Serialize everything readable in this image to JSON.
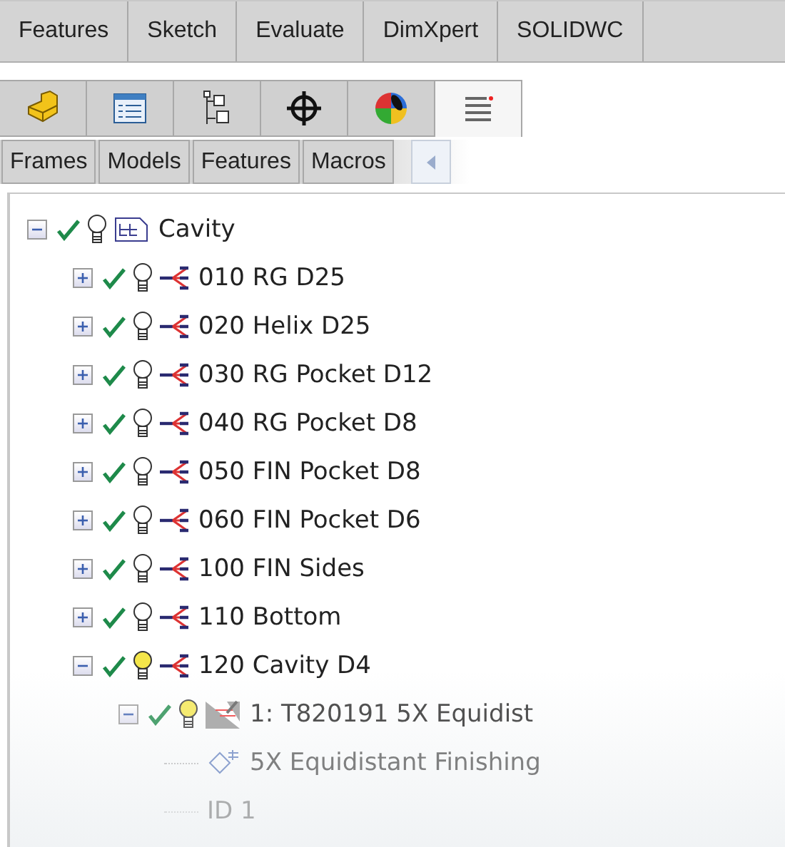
{
  "command_tabs": [
    {
      "label": "Features",
      "selected": false
    },
    {
      "label": "Sketch",
      "selected": false
    },
    {
      "label": "Evaluate",
      "selected": false
    },
    {
      "label": "DimXpert",
      "selected": false
    },
    {
      "label": "SOLIDWC",
      "selected": false
    }
  ],
  "panel_tabs": [
    {
      "kind": "part",
      "selected": false
    },
    {
      "kind": "property",
      "selected": false
    },
    {
      "kind": "config",
      "selected": false
    },
    {
      "kind": "target",
      "selected": false
    },
    {
      "kind": "appearance",
      "selected": false
    },
    {
      "kind": "list",
      "selected": true
    }
  ],
  "sub_tabs": [
    {
      "label": "Frames",
      "selected": false
    },
    {
      "label": "Models",
      "selected": false
    },
    {
      "label": "Features",
      "selected": false
    },
    {
      "label": "Macros",
      "selected": false
    }
  ],
  "tree": [
    {
      "kind": "part",
      "label": "Cavity",
      "expanded": true,
      "checked": true,
      "lit": false,
      "children": [
        {
          "kind": "group",
          "label": "010 RG D25",
          "expanded": false,
          "checked": true,
          "lit": false
        },
        {
          "kind": "group",
          "label": "020 Helix D25",
          "expanded": false,
          "checked": true,
          "lit": false
        },
        {
          "kind": "group",
          "label": "030 RG Pocket D12",
          "expanded": false,
          "checked": true,
          "lit": false
        },
        {
          "kind": "group",
          "label": "040 RG Pocket D8",
          "expanded": false,
          "checked": true,
          "lit": false
        },
        {
          "kind": "group",
          "label": "050 FIN Pocket D8",
          "expanded": false,
          "checked": true,
          "lit": false
        },
        {
          "kind": "group",
          "label": "060 FIN Pocket D6",
          "expanded": false,
          "checked": true,
          "lit": false
        },
        {
          "kind": "group",
          "label": "100 FIN Sides",
          "expanded": false,
          "checked": true,
          "lit": false
        },
        {
          "kind": "group",
          "label": "110 Bottom",
          "expanded": false,
          "checked": true,
          "lit": false
        },
        {
          "kind": "group",
          "label": "120 Cavity D4",
          "expanded": true,
          "checked": true,
          "lit": true,
          "children": [
            {
              "kind": "operation",
              "label": "1: T820191 5X Equidist",
              "expanded": true,
              "checked": true,
              "lit": true,
              "children": [
                {
                  "kind": "strategy",
                  "label": "5X Equidistant Finishing"
                },
                {
                  "kind": "id",
                  "label": "ID 1"
                }
              ]
            }
          ]
        }
      ]
    }
  ]
}
